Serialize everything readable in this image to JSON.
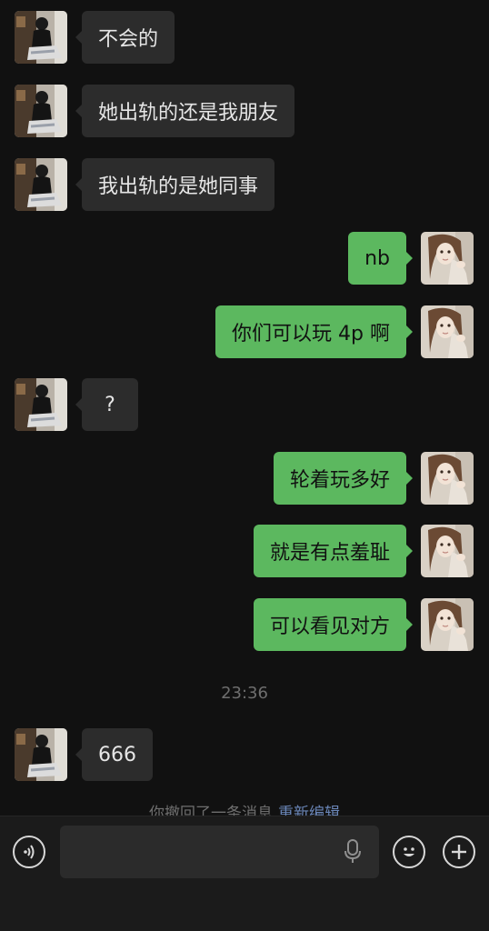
{
  "messages": [
    {
      "side": "in",
      "text": "不会的"
    },
    {
      "side": "in",
      "text": "她出轨的还是我朋友"
    },
    {
      "side": "in",
      "text": "我出轨的是她同事"
    },
    {
      "side": "out",
      "text": "nb"
    },
    {
      "side": "out",
      "text": "你们可以玩 4p 啊"
    },
    {
      "side": "in",
      "text": "?"
    },
    {
      "side": "out",
      "text": "轮着玩多好"
    },
    {
      "side": "out",
      "text": "就是有点羞耻"
    },
    {
      "side": "out",
      "text": "可以看见对方"
    },
    {
      "side": "in",
      "text": "666"
    }
  ],
  "timestamp": "23:36",
  "recall_notice": {
    "text": "你撤回了一条消息",
    "action": "重新编辑"
  },
  "input_bar": {
    "value": "",
    "icons": [
      "voice-icon",
      "microphone-icon",
      "emoji-icon",
      "plus-icon"
    ]
  },
  "colors": {
    "background": "#111111",
    "incoming_bubble": "#2c2c2c",
    "outgoing_bubble": "#5cb85f",
    "link": "#6a86b8"
  }
}
